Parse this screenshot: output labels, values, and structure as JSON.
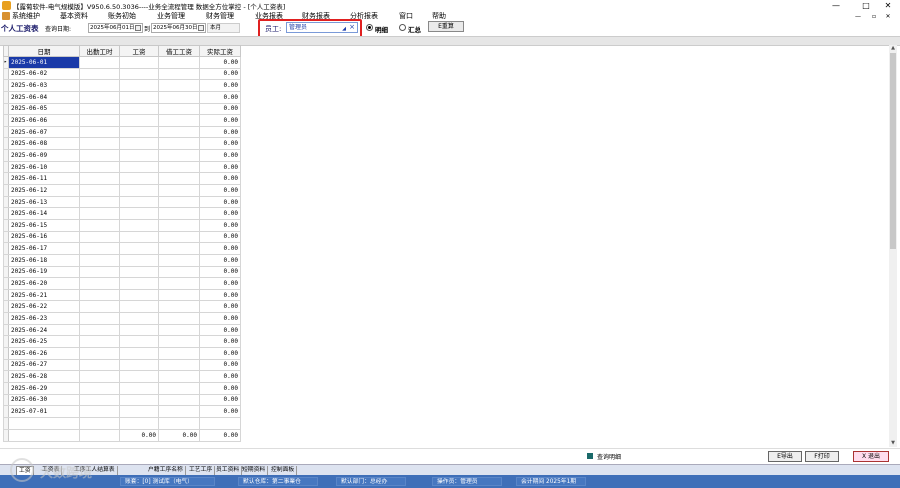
{
  "window": {
    "title": "【露葡软件-电气规模版】V950.6.50.3036----业务全流程管理 数据全方位掌控 - [个人工资表]",
    "controls": {
      "minimize": "—",
      "maximize": "□",
      "close": "✕"
    },
    "mdi_controls": {
      "minimize": "—",
      "restore": "▫",
      "close": "✕"
    }
  },
  "menu": {
    "items": [
      "系统维护",
      "基本资料",
      "账务初始",
      "业务管理",
      "财务管理",
      "业务报表",
      "财务报表",
      "分析报表",
      "窗口",
      "帮助"
    ]
  },
  "toolbar": {
    "page_title": "个人工资表",
    "query_date_label": "查询日期:",
    "date_from": "2025年06月01日",
    "to_label": "到",
    "date_to": "2025年06月30日",
    "period": "本月",
    "employee_label": "员工:",
    "employee_value": "管理员",
    "radio_detail": "明细",
    "radio_summary": "汇总",
    "refresh_label": "E重算"
  },
  "grid": {
    "columns": [
      "日期",
      "出勤工时",
      "工资",
      "借工工资",
      "实际工资"
    ],
    "rows": [
      {
        "date": "2025-06-01",
        "actual": "0.00"
      },
      {
        "date": "2025-06-02",
        "actual": "0.00"
      },
      {
        "date": "2025-06-03",
        "actual": "0.00"
      },
      {
        "date": "2025-06-04",
        "actual": "0.00"
      },
      {
        "date": "2025-06-05",
        "actual": "0.00"
      },
      {
        "date": "2025-06-06",
        "actual": "0.00"
      },
      {
        "date": "2025-06-07",
        "actual": "0.00"
      },
      {
        "date": "2025-06-08",
        "actual": "0.00"
      },
      {
        "date": "2025-06-09",
        "actual": "0.00"
      },
      {
        "date": "2025-06-10",
        "actual": "0.00"
      },
      {
        "date": "2025-06-11",
        "actual": "0.00"
      },
      {
        "date": "2025-06-12",
        "actual": "0.00"
      },
      {
        "date": "2025-06-13",
        "actual": "0.00"
      },
      {
        "date": "2025-06-14",
        "actual": "0.00"
      },
      {
        "date": "2025-06-15",
        "actual": "0.00"
      },
      {
        "date": "2025-06-16",
        "actual": "0.00"
      },
      {
        "date": "2025-06-17",
        "actual": "0.00"
      },
      {
        "date": "2025-06-18",
        "actual": "0.00"
      },
      {
        "date": "2025-06-19",
        "actual": "0.00"
      },
      {
        "date": "2025-06-20",
        "actual": "0.00"
      },
      {
        "date": "2025-06-21",
        "actual": "0.00"
      },
      {
        "date": "2025-06-22",
        "actual": "0.00"
      },
      {
        "date": "2025-06-23",
        "actual": "0.00"
      },
      {
        "date": "2025-06-24",
        "actual": "0.00"
      },
      {
        "date": "2025-06-25",
        "actual": "0.00"
      },
      {
        "date": "2025-06-26",
        "actual": "0.00"
      },
      {
        "date": "2025-06-27",
        "actual": "0.00"
      },
      {
        "date": "2025-06-28",
        "actual": "0.00"
      },
      {
        "date": "2025-06-29",
        "actual": "0.00"
      },
      {
        "date": "2025-06-30",
        "actual": "0.00"
      },
      {
        "date": "2025-07-01",
        "actual": "0.00"
      }
    ],
    "totals": {
      "wage": "0.00",
      "borrowed": "0.00",
      "actual": "0.00"
    }
  },
  "bottom": {
    "legend_label": "查询明细",
    "export_label": "E导出",
    "print_label": "F打印",
    "exit_label": "X 退出"
  },
  "tabs": [
    "工资",
    "工资表",
    "工序工人结算表",
    "户籍工序名称",
    "工艺工序",
    "员工资料",
    "短期资料",
    "控制面板"
  ],
  "status": {
    "account_set": "账套：[0] 测试库（电气）",
    "default_warehouse": "默认仓库：第二事業仓",
    "default_dept": "默认部门：总经办",
    "operator": "操作员：管理员",
    "period": "会计期间 2025年1期"
  },
  "watermark": {
    "text": "大数跨境"
  },
  "colors": {
    "status_bar": "#3f6fb8",
    "selection": "#1a3aa8",
    "highlight_box": "#e02020"
  }
}
